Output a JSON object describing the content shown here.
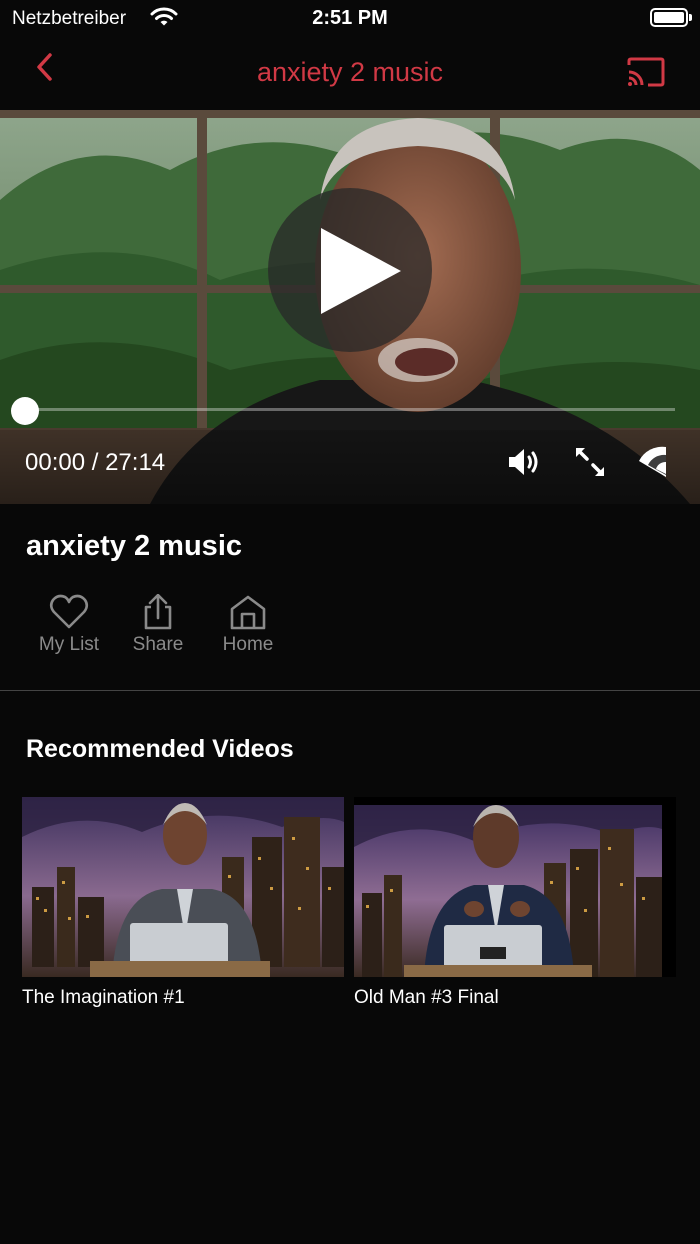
{
  "status_bar": {
    "carrier": "Netzbetreiber",
    "time": "2:51 PM",
    "battery_level": 1.0
  },
  "nav": {
    "title": "anxiety 2 music",
    "back_icon": "chevron-left-icon",
    "cast_icon": "cast-icon",
    "accent_color": "#d13945"
  },
  "player": {
    "current_time": "00:00",
    "separator": " / ",
    "duration": "27:14",
    "progress": 0.0,
    "controls": {
      "play_icon": "play-icon",
      "volume_icon": "volume-icon",
      "fullscreen_icon": "fullscreen-icon",
      "airplay_icon": "airplay-icon"
    }
  },
  "video": {
    "title": "anxiety 2 music",
    "actions": [
      {
        "label": "My List",
        "icon": "heart-icon"
      },
      {
        "label": "Share",
        "icon": "share-icon"
      },
      {
        "label": "Home",
        "icon": "home-icon"
      }
    ]
  },
  "recommended": {
    "title": "Recommended Videos",
    "items": [
      {
        "title": "The Imagination #1"
      },
      {
        "title": "Old Man #3 Final"
      }
    ]
  }
}
